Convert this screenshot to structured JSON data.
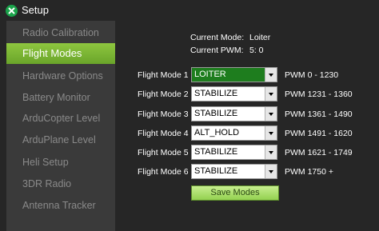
{
  "window": {
    "title": "Setup"
  },
  "sidebar": {
    "items": [
      {
        "label": "Radio Calibration",
        "active": false
      },
      {
        "label": "Flight Modes",
        "active": true
      },
      {
        "label": "Hardware Options",
        "active": false
      },
      {
        "label": "Battery Monitor",
        "active": false
      },
      {
        "label": "ArduCopter Level",
        "active": false
      },
      {
        "label": "ArduPlane Level",
        "active": false
      },
      {
        "label": "Heli Setup",
        "active": false
      },
      {
        "label": "3DR Radio",
        "active": false
      },
      {
        "label": "Antenna Tracker",
        "active": false
      }
    ]
  },
  "status": {
    "mode_label": "Current Mode:",
    "mode_value": "Loiter",
    "pwm_label": "Current PWM:",
    "pwm_value": "5: 0"
  },
  "flight_modes": [
    {
      "label": "Flight Mode 1",
      "value": "LOITER",
      "pwm": "PWM 0 - 1230",
      "selected": true
    },
    {
      "label": "Flight Mode 2",
      "value": "STABILIZE",
      "pwm": "PWM 1231 - 1360",
      "selected": false
    },
    {
      "label": "Flight Mode 3",
      "value": "STABILIZE",
      "pwm": "PWM 1361 - 1490",
      "selected": false
    },
    {
      "label": "Flight Mode 4",
      "value": "ALT_HOLD",
      "pwm": "PWM 1491 - 1620",
      "selected": false
    },
    {
      "label": "Flight Mode 5",
      "value": "STABILIZE",
      "pwm": "PWM 1621 - 1749",
      "selected": false
    },
    {
      "label": "Flight Mode 6",
      "value": "STABILIZE",
      "pwm": "PWM 1750 +",
      "selected": false
    }
  ],
  "save_button": {
    "label": "Save Modes"
  },
  "colors": {
    "accent": "#7cb535",
    "selected_combo": "#1e7d1e",
    "background": "#262626"
  }
}
